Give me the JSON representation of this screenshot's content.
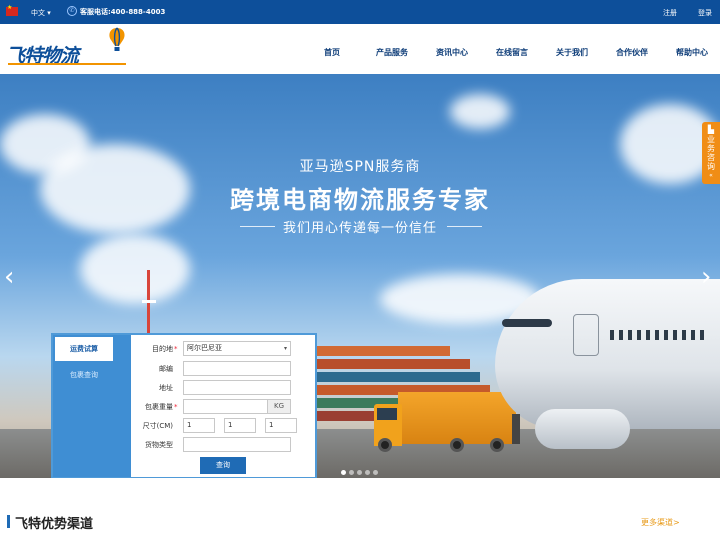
{
  "topbar": {
    "language": "中文 ▾",
    "phone": "客服电话:400-888-4003",
    "register": "注册",
    "login": "登录"
  },
  "header": {
    "logo_text": "飞特物流",
    "nav": [
      "首页",
      "产品服务",
      "资讯中心",
      "在线留言",
      "关于我们",
      "合作伙伴",
      "帮助中心"
    ]
  },
  "hero": {
    "sub_title": "亚马逊SPN服务商",
    "main_title": "跨境电商物流服务专家",
    "slogan": "我们用心传递每一份信任",
    "slides_count": 5,
    "active_slide": 1
  },
  "side_widget": {
    "label": "业务咨询",
    "arrow": "«"
  },
  "calculator": {
    "tabs": [
      "运费试算",
      "包裹查询"
    ],
    "active_tab": 0,
    "fields": {
      "destination": {
        "label": "目的地",
        "value": "阿尔巴尼亚"
      },
      "postcode": {
        "label": "邮编",
        "value": ""
      },
      "address": {
        "label": "地址",
        "value": ""
      },
      "weight": {
        "label": "包裹重量",
        "value": "",
        "unit": "KG"
      },
      "size": {
        "label": "尺寸(CM)",
        "values": [
          "1",
          "1",
          "1"
        ]
      },
      "cargo_type": {
        "label": "货物类型",
        "value": ""
      }
    },
    "submit": "查询"
  },
  "section": {
    "title": "飞特优势渠道",
    "more": "更多渠道>"
  },
  "colors": {
    "brand_blue": "#0d4f9a",
    "accent_orange": "#f08d16",
    "button_blue": "#1f6bb5"
  }
}
